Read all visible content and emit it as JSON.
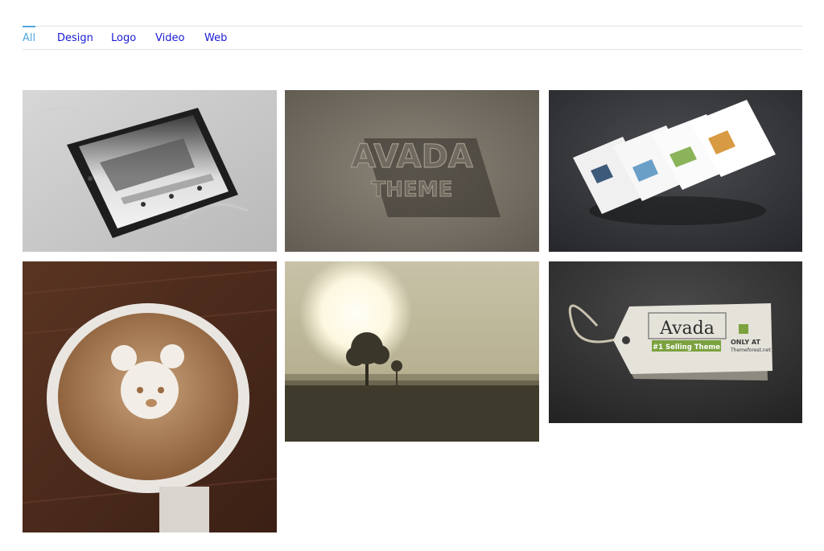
{
  "filters": {
    "items": [
      {
        "label": "All",
        "active": true
      },
      {
        "label": "Design",
        "active": false
      },
      {
        "label": "Logo",
        "active": false
      },
      {
        "label": "Video",
        "active": false
      },
      {
        "label": "Web",
        "active": false
      }
    ]
  },
  "colors": {
    "active_filter": "#4ea7e0",
    "filter_link": "#1b1bd6",
    "divider": "#e2e2e2"
  },
  "portfolio": {
    "avada_card": {
      "line1": "AVADA",
      "line2": "THEME"
    },
    "tag": {
      "brand": "Avada",
      "badge": "#1 Selling Theme",
      "only_at": "ONLY AT",
      "site": "Themeforest.net"
    }
  }
}
